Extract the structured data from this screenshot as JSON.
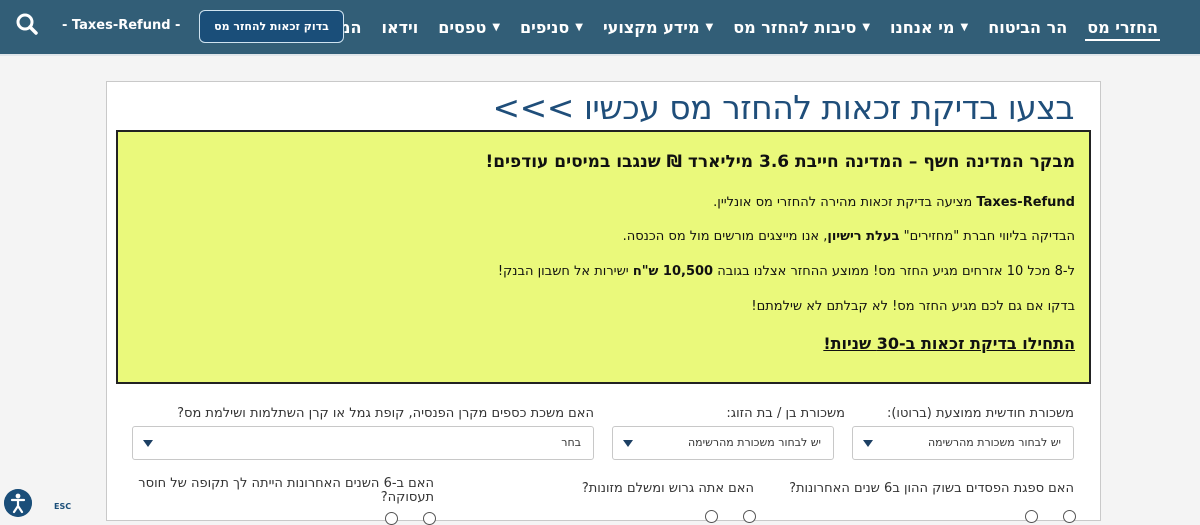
{
  "header": {
    "nav": [
      "החזרי מס",
      "הר הביטוח",
      "מי אנחנו",
      "סיבות להחזר מס",
      "מידע מקצועי",
      "סניפים",
      "טפסים",
      "וידאו",
      "המלצות"
    ],
    "nav_dropdowns": [
      false,
      false,
      true,
      true,
      true,
      true,
      true,
      false,
      false
    ],
    "active_index": 0,
    "cta_button": "בדוק זכאות להחזר מס",
    "brand": "- Taxes-Refund -",
    "search_icon": "search-icon"
  },
  "main": {
    "headline": "בצעו בדיקת זכאות להחזר מס עכשיו >>>",
    "notice": {
      "title": "מבקר המדינה חשף – המדינה חייבת 3.6 מיליארד ₪ שנגבו במיסים עודפים!",
      "p1_bold": "Taxes-Refund",
      "p1_rest": " מציעה בדיקת זכאות מהירה להחזרי מס אונליין.",
      "p2_pre": "הבדיקה בליווי חברת \"מחזירים\" ",
      "p2_bold": "בעלת רישיון",
      "p2_post": ", אנו מייצגים מורשים מול מס הכנסה.",
      "p3_pre": "ל-8 מכל 10 אזרחים מגיע החזר מס! ממוצע ההחזר אצלנו בגובה ",
      "p3_bold": "10,500 ש\"ח",
      "p3_post": " ישירות אל חשבון הבנק!",
      "p4": "בדקו אם גם לכם מגיע החזר מס! לא קבלתם לא שילמתם!",
      "cta_link": "התחילו בדיקת זכאות ב-30 שניות!"
    },
    "form": {
      "salary_label": "משכורת חודשית ממוצעת (ברוטו):",
      "salary_value": "יש לבחור משכורת מהרשימה",
      "spouse_label": "משכורת בן / בת הזוג:",
      "spouse_value": "יש לבחור משכורת מהרשימה",
      "pension_label": "האם משכת כספים מקרן הפנסיה, קופת גמל או קרן השתלמות ושילמת מס?",
      "pension_value": "בחר",
      "q_losses": "האם ספגת הפסדים בשוק ההון ב6 שנים האחרונות?",
      "q_divorced": "האם אתה גרוש ומשלם מזונות?",
      "q_unemployed": "האם ב-6 השנים האחרונות הייתה לך תקופה של חוסר תעסוקה?"
    }
  },
  "accessibility": {
    "icon": "accessibility-icon",
    "esc_label": "ESC"
  },
  "colors": {
    "topbar": "#325e77",
    "headline": "#1f4e7a",
    "notice_bg": "#eaf97b",
    "cta_bg": "#1a4e79"
  }
}
